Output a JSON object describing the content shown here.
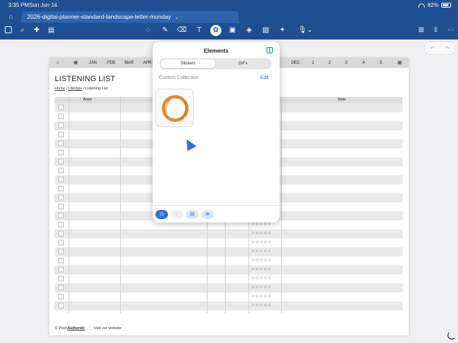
{
  "status": {
    "time": "3:35 PM",
    "date": "Sun Jun 14",
    "battery": "82%",
    "battery_level": 0.82
  },
  "tabs": {
    "document_title": "2026-digital-planner-standard-landscape-letter-monday",
    "chevron": "⌄"
  },
  "toolbar": {
    "left_icons": [
      "sidebar-icon",
      "search-icon",
      "bookmark-add-icon",
      "document-icon"
    ],
    "center_icons": [
      "lasso-icon",
      "pen-icon",
      "eraser-icon",
      "text-box-icon",
      "elements-icon",
      "image-icon",
      "shapes-icon",
      "sticky-note-icon",
      "laser-pointer-icon",
      "microphone-icon"
    ],
    "right_icons": [
      "add-page-icon",
      "share-icon",
      "more-icon"
    ]
  },
  "planner": {
    "nav": [
      "JAN",
      "FEB",
      "MAR",
      "APR",
      "DEC",
      "1",
      "2",
      "3",
      "4",
      "5"
    ],
    "title": "LISTENING LIST",
    "breadcrumb": {
      "home": "Home",
      "section": "Lifestyle",
      "current": "Listening List",
      "separator": "/"
    },
    "columns": {
      "artist": "Artist",
      "note": "Note"
    },
    "stars": "☆☆☆☆☆",
    "footer": {
      "brand_prefix": "© Posh",
      "brand_name": "Authentic",
      "link": "Visit our website"
    }
  },
  "elements_panel": {
    "title": "Elements",
    "tabs": [
      "Stickers",
      "GIFs"
    ],
    "selected_tab": "Stickers",
    "collection_label": "Custom Collection",
    "edit_label": "Edit",
    "bottom_buttons": [
      "clock-icon",
      "sticker-circle-icon",
      "image-icon",
      "add-icon"
    ]
  },
  "colors": {
    "toolbar_bg": "#1f4e93",
    "tab_bg": "#2f63ae",
    "accent": "#2f6fd8",
    "sticker_orange": "#e37b1b"
  }
}
